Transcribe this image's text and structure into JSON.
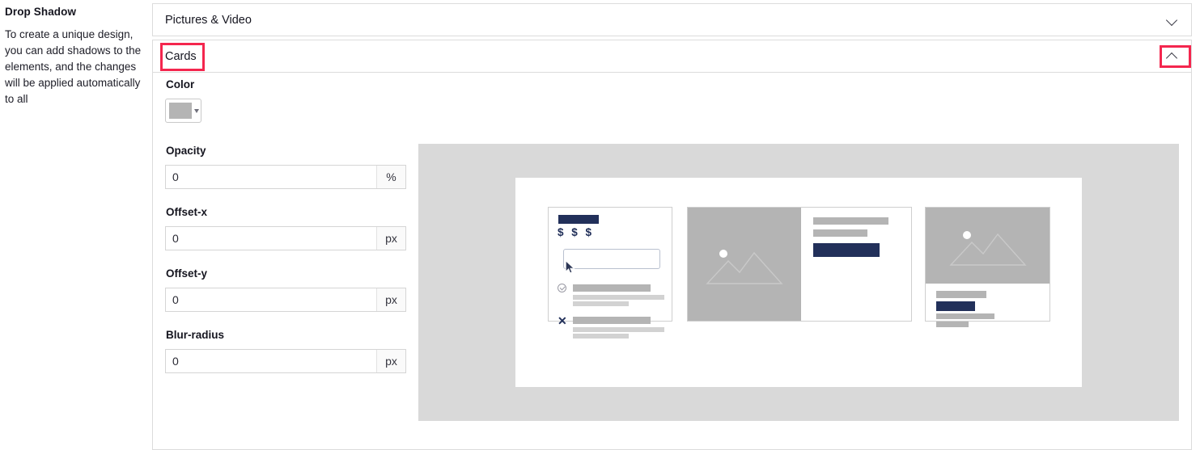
{
  "description": {
    "title": "Drop Shadow",
    "body": "To create a unique design, you can add shadows to the elements, and the changes will be applied automatically to all"
  },
  "accordion": {
    "sections": [
      {
        "title": "Pictures & Video",
        "chevron_icon": "chevron-down-icon",
        "expanded": "false"
      },
      {
        "title": "Cards",
        "chevron_icon": "chevron-up-icon",
        "expanded": "true"
      }
    ]
  },
  "form": {
    "color": {
      "label": "Color",
      "swatch_color": "#b4b4b4",
      "caret_icon": "caret-down-icon"
    },
    "fields": [
      {
        "label": "Opacity",
        "value": "0",
        "unit": "%"
      },
      {
        "label": "Offset-x",
        "value": "0",
        "unit": "px"
      },
      {
        "label": "Offset-y",
        "value": "0",
        "unit": "px"
      },
      {
        "label": "Blur-radius",
        "value": "0",
        "unit": "px"
      }
    ]
  },
  "preview": {
    "panel_background": "#d9d9d9",
    "canvas_background": "#ffffff",
    "cards": [
      {
        "name": "form-card",
        "title_bar_color": "#22305a",
        "price_text": "$ $ $",
        "input_placeholder": "",
        "cursor_icon": "mouse-pointer-icon",
        "rows": [
          {
            "icon": "check-circle-icon"
          },
          {
            "icon": "close-x-icon"
          }
        ]
      },
      {
        "name": "horizontal-media-card",
        "image_icon": "image-placeholder-icon",
        "button_color": "#22305a"
      },
      {
        "name": "vertical-media-card",
        "image_icon": "image-placeholder-icon",
        "button_color": "#22305a"
      }
    ]
  },
  "annotations": {
    "highlight_color": "#f4264e",
    "boxes": [
      {
        "name": "cards-title-highlight"
      },
      {
        "name": "cards-chevron-highlight"
      }
    ]
  }
}
